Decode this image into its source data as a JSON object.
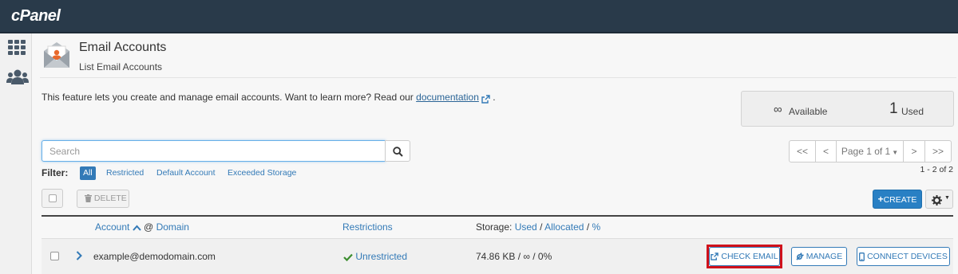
{
  "brand": {
    "logo": "cPanel"
  },
  "header": {
    "title": "Email Accounts",
    "subtitle": "List Email Accounts"
  },
  "intro": {
    "text": "This feature lets you create and manage email accounts. Want to learn more? Read our ",
    "link": "documentation",
    "suffix": "."
  },
  "stats": {
    "available_symbol": "∞",
    "available_label": "Available",
    "used_count": "1",
    "used_label": "Used"
  },
  "search": {
    "placeholder": "Search",
    "value": ""
  },
  "filter": {
    "label": "Filter:",
    "options": [
      "All",
      "Restricted",
      "Default Account",
      "Exceeded Storage"
    ],
    "selected": "All"
  },
  "pagination": {
    "first": "<<",
    "prev": "<",
    "page_label": "Page 1 of 1",
    "next": ">",
    "last": ">>",
    "range": "1 - 2 of 2"
  },
  "toolbar": {
    "delete_label": "DELETE",
    "create_label": "CREATE"
  },
  "table": {
    "col_account": "Account",
    "col_at": "@",
    "col_domain": "Domain",
    "col_restrictions": "Restrictions",
    "col_storage_prefix": "Storage:",
    "col_storage_used": "Used",
    "col_storage_allocated": "Allocated",
    "col_storage_pct": "%",
    "sep": "/",
    "rows": [
      {
        "account": "example@demodomain.com",
        "restriction": "Unrestricted",
        "storage": "74.86 KB / ∞ / 0%",
        "actions": {
          "check_email": "CHECK EMAIL",
          "manage": "MANAGE",
          "connect": "CONNECT DEVICES"
        }
      }
    ]
  },
  "colors": {
    "topbar": "#293a4a",
    "link": "#337ab7",
    "primary": "#2980c4",
    "highlight": "#d0111b",
    "success": "#3c8d2f"
  },
  "icons": {
    "sidebar": [
      "apps-grid-icon",
      "users-icon"
    ],
    "header": "email-envelope-icon"
  }
}
